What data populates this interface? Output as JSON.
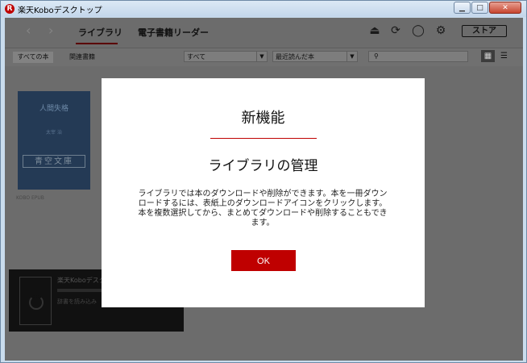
{
  "window": {
    "title": "楽天Koboデスクトップ",
    "app_icon": "R",
    "buttons": {
      "minimize": "▁",
      "maximize": "□",
      "close": "✕"
    }
  },
  "topnav": {
    "back_icon": "‹",
    "forward_icon": "›",
    "tabs": [
      {
        "label": "ライブラリ",
        "active": true
      },
      {
        "label": "電子書籍リーダー",
        "active": false
      }
    ],
    "icons": {
      "eject": "⏏",
      "sync": "⟳",
      "account": "◯",
      "settings": "⚙"
    },
    "store_label": "ストア"
  },
  "filterbar": {
    "all_books": "すべての本",
    "related": "関連書籍",
    "filter_value": "すべて",
    "sort_value": "最近読んだ本",
    "dropdown_arrow": "▼",
    "search_icon": "⚲",
    "view_grid": "▦",
    "view_list": "☰"
  },
  "book": {
    "title": "人間失格",
    "author": "太宰 治",
    "publisher": "青空文庫",
    "format": "KOBO EPUB"
  },
  "download": {
    "title": "楽天Koboデスク",
    "status": "辞書を読み込み"
  },
  "modal": {
    "heading": "新機能",
    "title": "ライブラリの管理",
    "body": "ライブラリでは本のダウンロードや削除ができます。本を一冊ダウンロードするには、表紙上のダウンロードアイコンをクリックします。本を複数選択してから、まとめてダウンロードや削除することもできます。",
    "ok": "OK"
  },
  "colors": {
    "accent": "#bf0000",
    "overlay_bg": "#6c6c6c",
    "modal_bg": "#ffffff"
  }
}
